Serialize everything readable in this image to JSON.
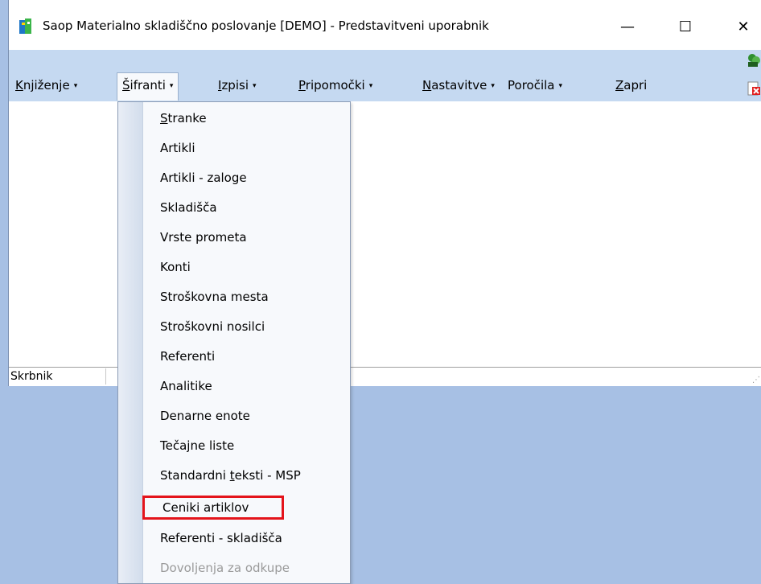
{
  "window": {
    "title": "Saop  Materialno skladiščno poslovanje [DEMO] - Predstavitveni uporabnik",
    "min_glyph": "—",
    "max_glyph": "☐",
    "close_glyph": "✕"
  },
  "menubar": {
    "items": [
      {
        "pre": "",
        "u": "K",
        "post": "njiženje"
      },
      {
        "pre": "",
        "u": "Š",
        "post": "ifranti"
      },
      {
        "pre": "",
        "u": "I",
        "post": "zpisi"
      },
      {
        "pre": "",
        "u": "P",
        "post": "ripomočki"
      },
      {
        "pre": "",
        "u": "N",
        "post": "astavitve"
      },
      {
        "pre": "",
        "u": "",
        "post": "Poročila"
      },
      {
        "pre": "",
        "u": "Z",
        "post": "apri"
      }
    ],
    "caret": "▾"
  },
  "dropdown": {
    "items": [
      {
        "pre": "",
        "u": "S",
        "post": "tranke"
      },
      {
        "pre": "Artikli",
        "u": "",
        "post": ""
      },
      {
        "pre": "Artikli - zaloge",
        "u": "",
        "post": ""
      },
      {
        "pre": "Skladišča",
        "u": "",
        "post": ""
      },
      {
        "pre": "Vrste prometa",
        "u": "",
        "post": ""
      },
      {
        "pre": "Konti",
        "u": "",
        "post": ""
      },
      {
        "pre": "Stroškovna mesta",
        "u": "",
        "post": ""
      },
      {
        "pre": "Stroškovni nosilci",
        "u": "",
        "post": ""
      },
      {
        "pre": "Referenti",
        "u": "",
        "post": ""
      },
      {
        "pre": "Analitike",
        "u": "",
        "post": ""
      },
      {
        "pre": "Denarne enote",
        "u": "",
        "post": ""
      },
      {
        "pre": "Tečajne liste",
        "u": "",
        "post": ""
      },
      {
        "pre": "Standardni ",
        "u": "t",
        "post": "eksti - MSP"
      },
      {
        "pre": "Ceniki artiklov",
        "u": "",
        "post": ""
      },
      {
        "pre": "Referenti - skladišča",
        "u": "",
        "post": ""
      },
      {
        "pre": "Dovoljenja za odkupe",
        "u": "",
        "post": ""
      }
    ]
  },
  "statusbar": {
    "text": "Skrbnik"
  },
  "colors": {
    "highlight_border": "#e4141b",
    "menubar_bg": "#c5d9f1",
    "desktop_bg": "#a7c0e4"
  }
}
